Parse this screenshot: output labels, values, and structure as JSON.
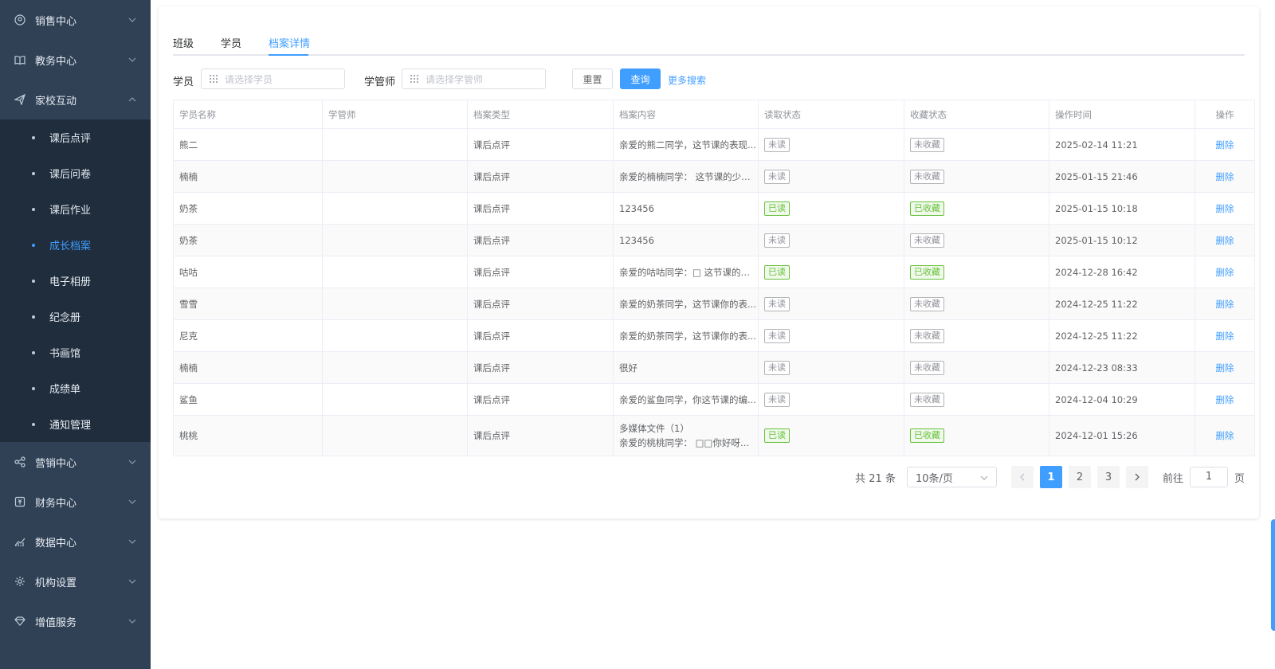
{
  "sidebar": {
    "groups_top": [
      {
        "label": "销售中心",
        "icon": "user-circle-icon"
      },
      {
        "label": "教务中心",
        "icon": "book-icon"
      },
      {
        "label": "家校互动",
        "icon": "send-icon"
      }
    ],
    "sub_items": [
      {
        "label": "课后点评",
        "active": false
      },
      {
        "label": "课后问卷",
        "active": false
      },
      {
        "label": "课后作业",
        "active": false
      },
      {
        "label": "成长档案",
        "active": true
      },
      {
        "label": "电子相册",
        "active": false
      },
      {
        "label": "纪念册",
        "active": false
      },
      {
        "label": "书画馆",
        "active": false
      },
      {
        "label": "成绩单",
        "active": false
      },
      {
        "label": "通知管理",
        "active": false
      }
    ],
    "groups_bottom": [
      {
        "label": "营销中心",
        "icon": "share-icon"
      },
      {
        "label": "财务中心",
        "icon": "finance-icon"
      },
      {
        "label": "数据中心",
        "icon": "chart-icon"
      },
      {
        "label": "机构设置",
        "icon": "gear-icon"
      },
      {
        "label": "增值服务",
        "icon": "diamond-icon"
      }
    ]
  },
  "tabs": [
    {
      "label": "班级",
      "active": false
    },
    {
      "label": "学员",
      "active": false
    },
    {
      "label": "档案详情",
      "active": true
    }
  ],
  "filter": {
    "student_label": "学员",
    "student_placeholder": "请选择学员",
    "manager_label": "学管师",
    "manager_placeholder": "请选择学管师",
    "reset": "重置",
    "query": "查询",
    "more": "更多搜索"
  },
  "table": {
    "columns": [
      "学员名称",
      "学管师",
      "档案类型",
      "档案内容",
      "读取状态",
      "收藏状态",
      "操作时间",
      "操作"
    ],
    "rows": [
      {
        "name": "熊二",
        "manager": "",
        "type": "课后点评",
        "content": "亲爱的熊二同学，这节课的表现...",
        "read": "未读",
        "fav": "未收藏",
        "time": "2025-02-14 11:21",
        "op": "删除"
      },
      {
        "name": "楠楠",
        "manager": "",
        "type": "课后点评",
        "content": "亲爱的楠楠同学： 这节课的少儿...",
        "read": "未读",
        "fav": "未收藏",
        "time": "2025-01-15 21:46",
        "op": "删除"
      },
      {
        "name": "奶茶",
        "manager": "",
        "type": "课后点评",
        "content": "123456",
        "read": "已读",
        "fav": "已收藏",
        "time": "2025-01-15 10:18",
        "op": "删除"
      },
      {
        "name": "奶茶",
        "manager": "",
        "type": "课后点评",
        "content": "123456",
        "read": "未读",
        "fav": "未收藏",
        "time": "2025-01-15 10:12",
        "op": "删除"
      },
      {
        "name": "咕咕",
        "manager": "",
        "type": "课后点评",
        "content": "亲爱的咕咕同学：□ 这节课的儿...",
        "read": "已读",
        "fav": "已收藏",
        "time": "2024-12-28 16:42",
        "op": "删除"
      },
      {
        "name": "雪雪",
        "manager": "",
        "type": "课后点评",
        "content": "亲爱的奶茶同学，这节课你的表...",
        "read": "未读",
        "fav": "未收藏",
        "time": "2024-12-25 11:22",
        "op": "删除"
      },
      {
        "name": "尼克",
        "manager": "",
        "type": "课后点评",
        "content": "亲爱的奶茶同学，这节课你的表...",
        "read": "未读",
        "fav": "未收藏",
        "time": "2024-12-25 11:22",
        "op": "删除"
      },
      {
        "name": "楠楠",
        "manager": "",
        "type": "课后点评",
        "content": "很好",
        "read": "未读",
        "fav": "未收藏",
        "time": "2024-12-23 08:33",
        "op": "删除"
      },
      {
        "name": "鲨鱼",
        "manager": "",
        "type": "课后点评",
        "content": "亲爱的鲨鱼同学，你这节课的编...",
        "read": "未读",
        "fav": "未收藏",
        "time": "2024-12-04 10:29",
        "op": "删除"
      },
      {
        "name": "桃桃",
        "manager": "",
        "type": "课后点评",
        "content": "多媒体文件（1）",
        "content2": "亲爱的桃桃同学： □□你好呀！这...",
        "read": "已读",
        "fav": "已收藏",
        "time": "2024-12-01 15:26",
        "op": "删除"
      }
    ]
  },
  "pagination": {
    "total": "共 21 条",
    "page_size": "10条/页",
    "pages": [
      "1",
      "2",
      "3"
    ],
    "current": "1",
    "goto_label": "前往",
    "goto_value": "1",
    "page_unit": "页"
  },
  "colors": {
    "sidebar_bg": "#304156",
    "submenu_bg": "#1f2d3d",
    "accent": "#409eff",
    "success": "#67c23a"
  }
}
